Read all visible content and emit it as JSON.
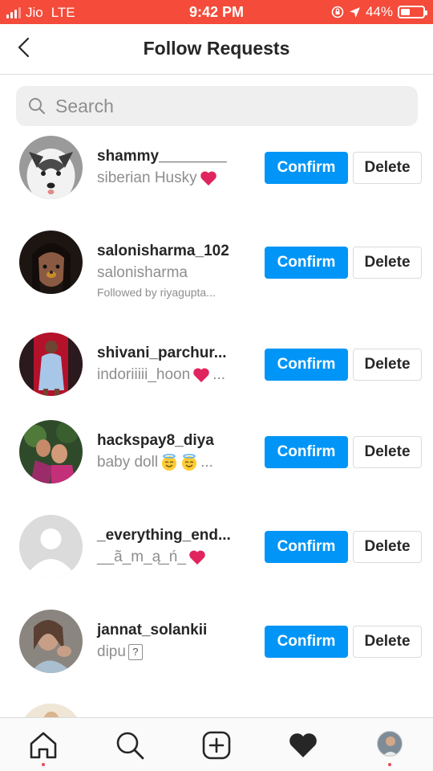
{
  "status_bar": {
    "carrier": "Jio",
    "network": "LTE",
    "time": "9:42 PM",
    "battery": "44%",
    "battery_level": 0.44,
    "bg_color": "#f44b3a"
  },
  "header": {
    "title": "Follow Requests",
    "back_icon": "chevron-left-icon"
  },
  "search": {
    "placeholder": "Search",
    "icon": "search-icon"
  },
  "requests": [
    {
      "username": "shammy________",
      "fullname": "siberian Husky",
      "emoji": [
        "red-heart"
      ],
      "note": ""
    },
    {
      "username": "salonisharma_102",
      "fullname": "salonisharma",
      "emoji": [],
      "note": "Followed by riyagupta..."
    },
    {
      "username": "shivani_parchur...",
      "fullname": "indoriiiii_hoon",
      "emoji": [
        "red-heart"
      ],
      "suffix": "...",
      "note": ""
    },
    {
      "username": "hackspay8_diya",
      "fullname": "baby doll",
      "emoji": [
        "halo-face",
        "halo-face"
      ],
      "suffix": "...",
      "note": ""
    },
    {
      "username": "_everything_end...",
      "fullname": "__ã_m_ą_ń_",
      "emoji": [
        "red-heart"
      ],
      "note": ""
    },
    {
      "username": "jannat_solankii",
      "fullname": "dipu",
      "emoji": [
        "unknown-glyph"
      ],
      "note": ""
    }
  ],
  "buttons": {
    "confirm": "Confirm",
    "delete": "Delete"
  },
  "unknown_glyph": "?",
  "tab_bar": {
    "items": [
      "home-icon",
      "search-icon",
      "new-post-icon",
      "activity-heart-icon",
      "profile-avatar"
    ]
  },
  "colors": {
    "accent": "#0095f6",
    "notification_dot": "#ed4956",
    "heart": "#e0245e"
  }
}
